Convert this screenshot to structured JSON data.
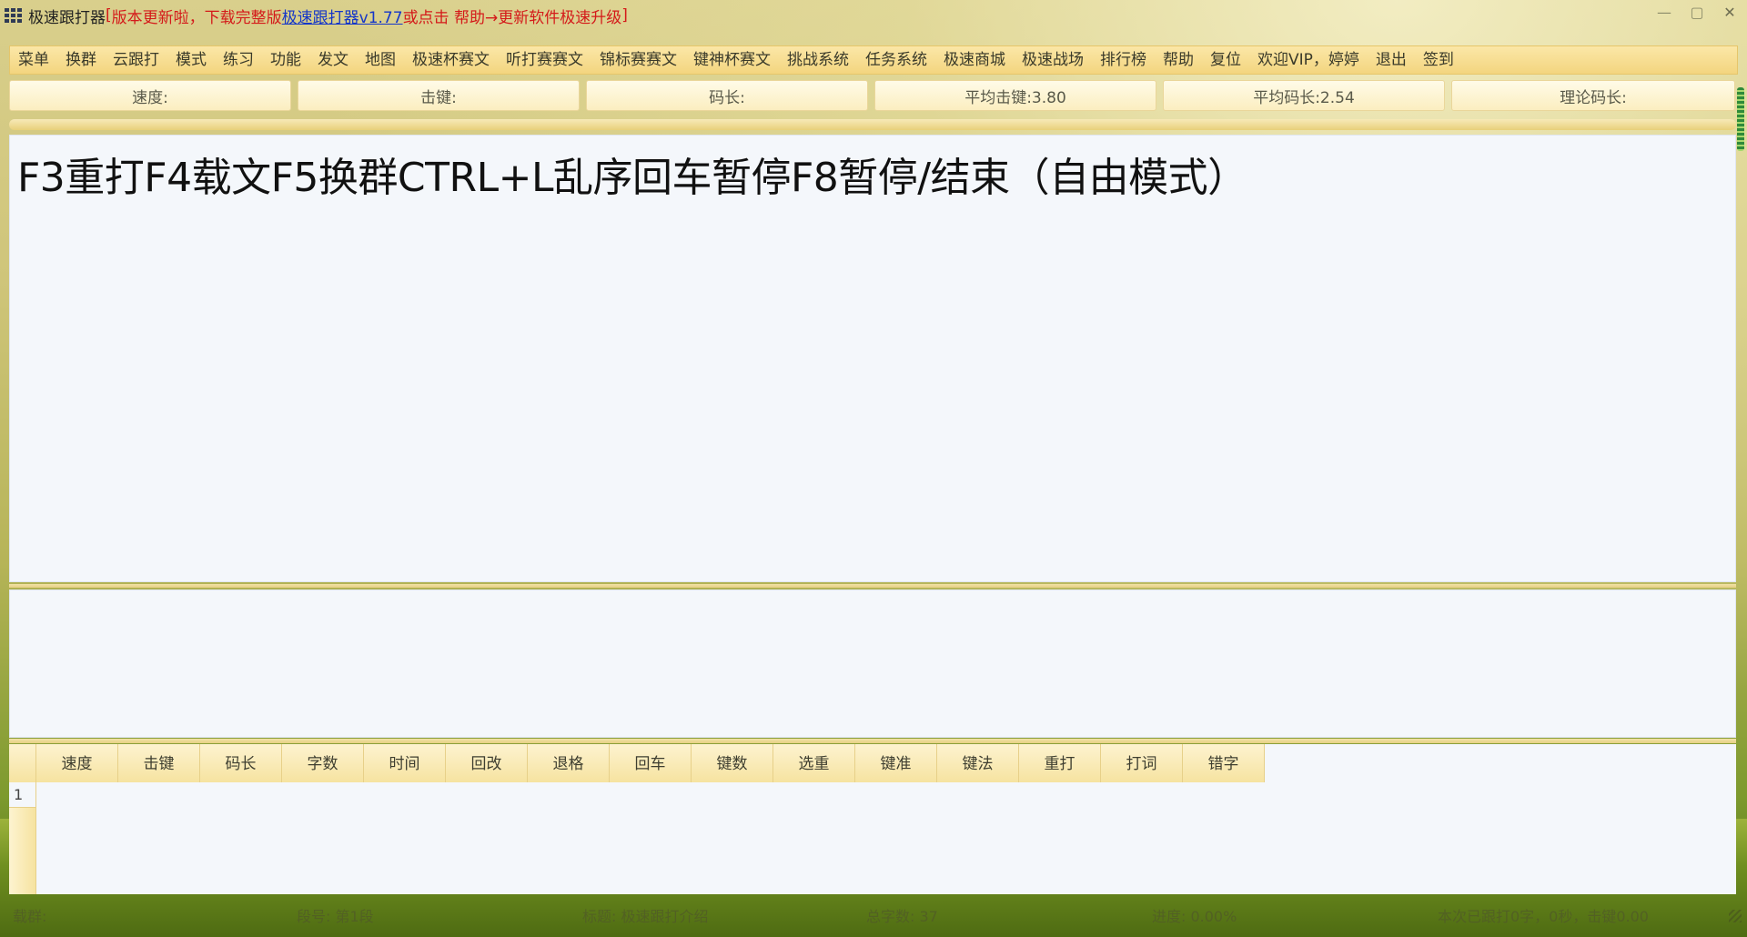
{
  "window": {
    "title": "极速跟打器",
    "notice_open": "[",
    "notice_text": "版本更新啦，下载完整版 ",
    "notice_link": "极速跟打器v1.77",
    "notice_tail": " 或点击 帮助→更新软件极速升级",
    "notice_close": "]"
  },
  "menu": {
    "items": [
      "菜单",
      "换群",
      "云跟打",
      "模式",
      "练习",
      "功能",
      "发文",
      "地图",
      "极速杯赛文",
      "听打赛赛文",
      "锦标赛赛文",
      "键神杯赛文",
      "挑战系统",
      "任务系统",
      "极速商城",
      "极速战场",
      "排行榜",
      "帮助",
      "复位",
      "欢迎VIP，婷婷",
      "退出",
      "签到"
    ]
  },
  "stats": {
    "speed": "速度:",
    "keystroke": "击键:",
    "code_length": "码长:",
    "avg_keystroke": "平均击键:3.80",
    "avg_code_length": "平均码长:2.54",
    "theory_code_length": "理论码长:"
  },
  "progress": {
    "percent": 0
  },
  "text_area": {
    "content": "F3重打F4载文F5换群CTRL+L乱序回车暂停F8暂停/结束（自由模式）"
  },
  "input_area": {
    "value": ""
  },
  "results_table": {
    "columns": [
      "速度",
      "击键",
      "码长",
      "字数",
      "时间",
      "回改",
      "退格",
      "回车",
      "键数",
      "选重",
      "键准",
      "键法",
      "重打",
      "打词",
      "错字"
    ],
    "row_number": "1"
  },
  "status": {
    "group": "载群:",
    "segment": "段号: 第1段",
    "title": "标题: 极速跟打介绍",
    "total_chars": "总字数: 37",
    "progress": "进度: 0.00%",
    "right": "本次已跟打0字，0秒，击键0.00"
  },
  "colors": {
    "menu_bg": "#f3d57f",
    "notice_red": "#d41a1a",
    "link_blue": "#1536c8",
    "text_area_bg": "#f4f7fb"
  }
}
